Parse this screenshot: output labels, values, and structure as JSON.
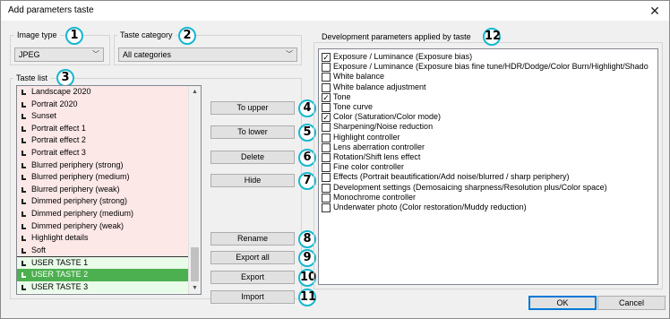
{
  "window": {
    "title": "Add parameters taste",
    "close_glyph": "✕"
  },
  "image_type": {
    "label": "Image type",
    "value": "JPEG",
    "arrow": "﹀"
  },
  "taste_category": {
    "label": "Taste category",
    "value": "All categories",
    "arrow": "﹀"
  },
  "taste_list": {
    "label": "Taste list",
    "items": [
      {
        "label": "Landscape 2020",
        "style": "pink"
      },
      {
        "label": "Portrait 2020",
        "style": "pink"
      },
      {
        "label": "Sunset",
        "style": "pink"
      },
      {
        "label": "Portrait effect 1",
        "style": "pink"
      },
      {
        "label": "Portrait effect 2",
        "style": "pink"
      },
      {
        "label": "Portrait effect 3",
        "style": "pink"
      },
      {
        "label": "Blurred periphery (strong)",
        "style": "pink"
      },
      {
        "label": "Blurred periphery (medium)",
        "style": "pink"
      },
      {
        "label": "Blurred periphery (weak)",
        "style": "pink"
      },
      {
        "label": "Dimmed periphery (strong)",
        "style": "pink"
      },
      {
        "label": "Dimmed periphery (medium)",
        "style": "pink"
      },
      {
        "label": "Dimmed periphery (weak)",
        "style": "pink"
      },
      {
        "label": "Highlight details",
        "style": "pink"
      },
      {
        "label": "Soft",
        "style": "pink"
      },
      {
        "label": "USER TASTE 1",
        "style": "green"
      },
      {
        "label": "USER TASTE 2",
        "style": "selected"
      },
      {
        "label": "USER TASTE 3",
        "style": "green"
      }
    ]
  },
  "buttons": {
    "to_upper": "To upper",
    "to_lower": "To lower",
    "delete": "Delete",
    "hide": "Hide",
    "rename": "Rename",
    "export_all": "Export all",
    "export": "Export",
    "import": "Import",
    "ok": "OK",
    "cancel": "Cancel"
  },
  "development": {
    "label": "Development parameters applied by taste",
    "params": [
      {
        "label": "Exposure / Luminance (Exposure bias)",
        "checked": true
      },
      {
        "label": "Exposure / Luminance (Exposure bias fine tune/HDR/Dodge/Color Burn/Highlight/Shado",
        "checked": false
      },
      {
        "label": "White balance",
        "checked": false
      },
      {
        "label": "White balance adjustment",
        "checked": false
      },
      {
        "label": "Tone",
        "checked": true
      },
      {
        "label": "Tone curve",
        "checked": false
      },
      {
        "label": "Color (Saturation/Color mode)",
        "checked": true
      },
      {
        "label": "Sharpening/Noise reduction",
        "checked": false
      },
      {
        "label": "Highlight controller",
        "checked": false
      },
      {
        "label": "Lens aberration controller",
        "checked": false
      },
      {
        "label": "Rotation/Shift lens effect",
        "checked": false
      },
      {
        "label": "Fine color controller",
        "checked": false
      },
      {
        "label": "Effects (Portrait beautification/Add noise/blurred / sharp periphery)",
        "checked": false
      },
      {
        "label": "Development settings (Demosaicing sharpness/Resolution plus/Color space)",
        "checked": false
      },
      {
        "label": "Monochrome controller",
        "checked": false
      },
      {
        "label": "Underwater photo (Color restoration/Muddy reduction)",
        "checked": false
      }
    ],
    "check_glyph": "✓"
  },
  "badges": [
    "1",
    "2",
    "3",
    "4",
    "5",
    "6",
    "7",
    "8",
    "9",
    "10",
    "11",
    "12"
  ],
  "colors": {
    "badge_border": "#14b8cf",
    "selected_row": "#4caf50",
    "builtin_row": "#fde8e8",
    "user_row": "#e9fbe9"
  }
}
